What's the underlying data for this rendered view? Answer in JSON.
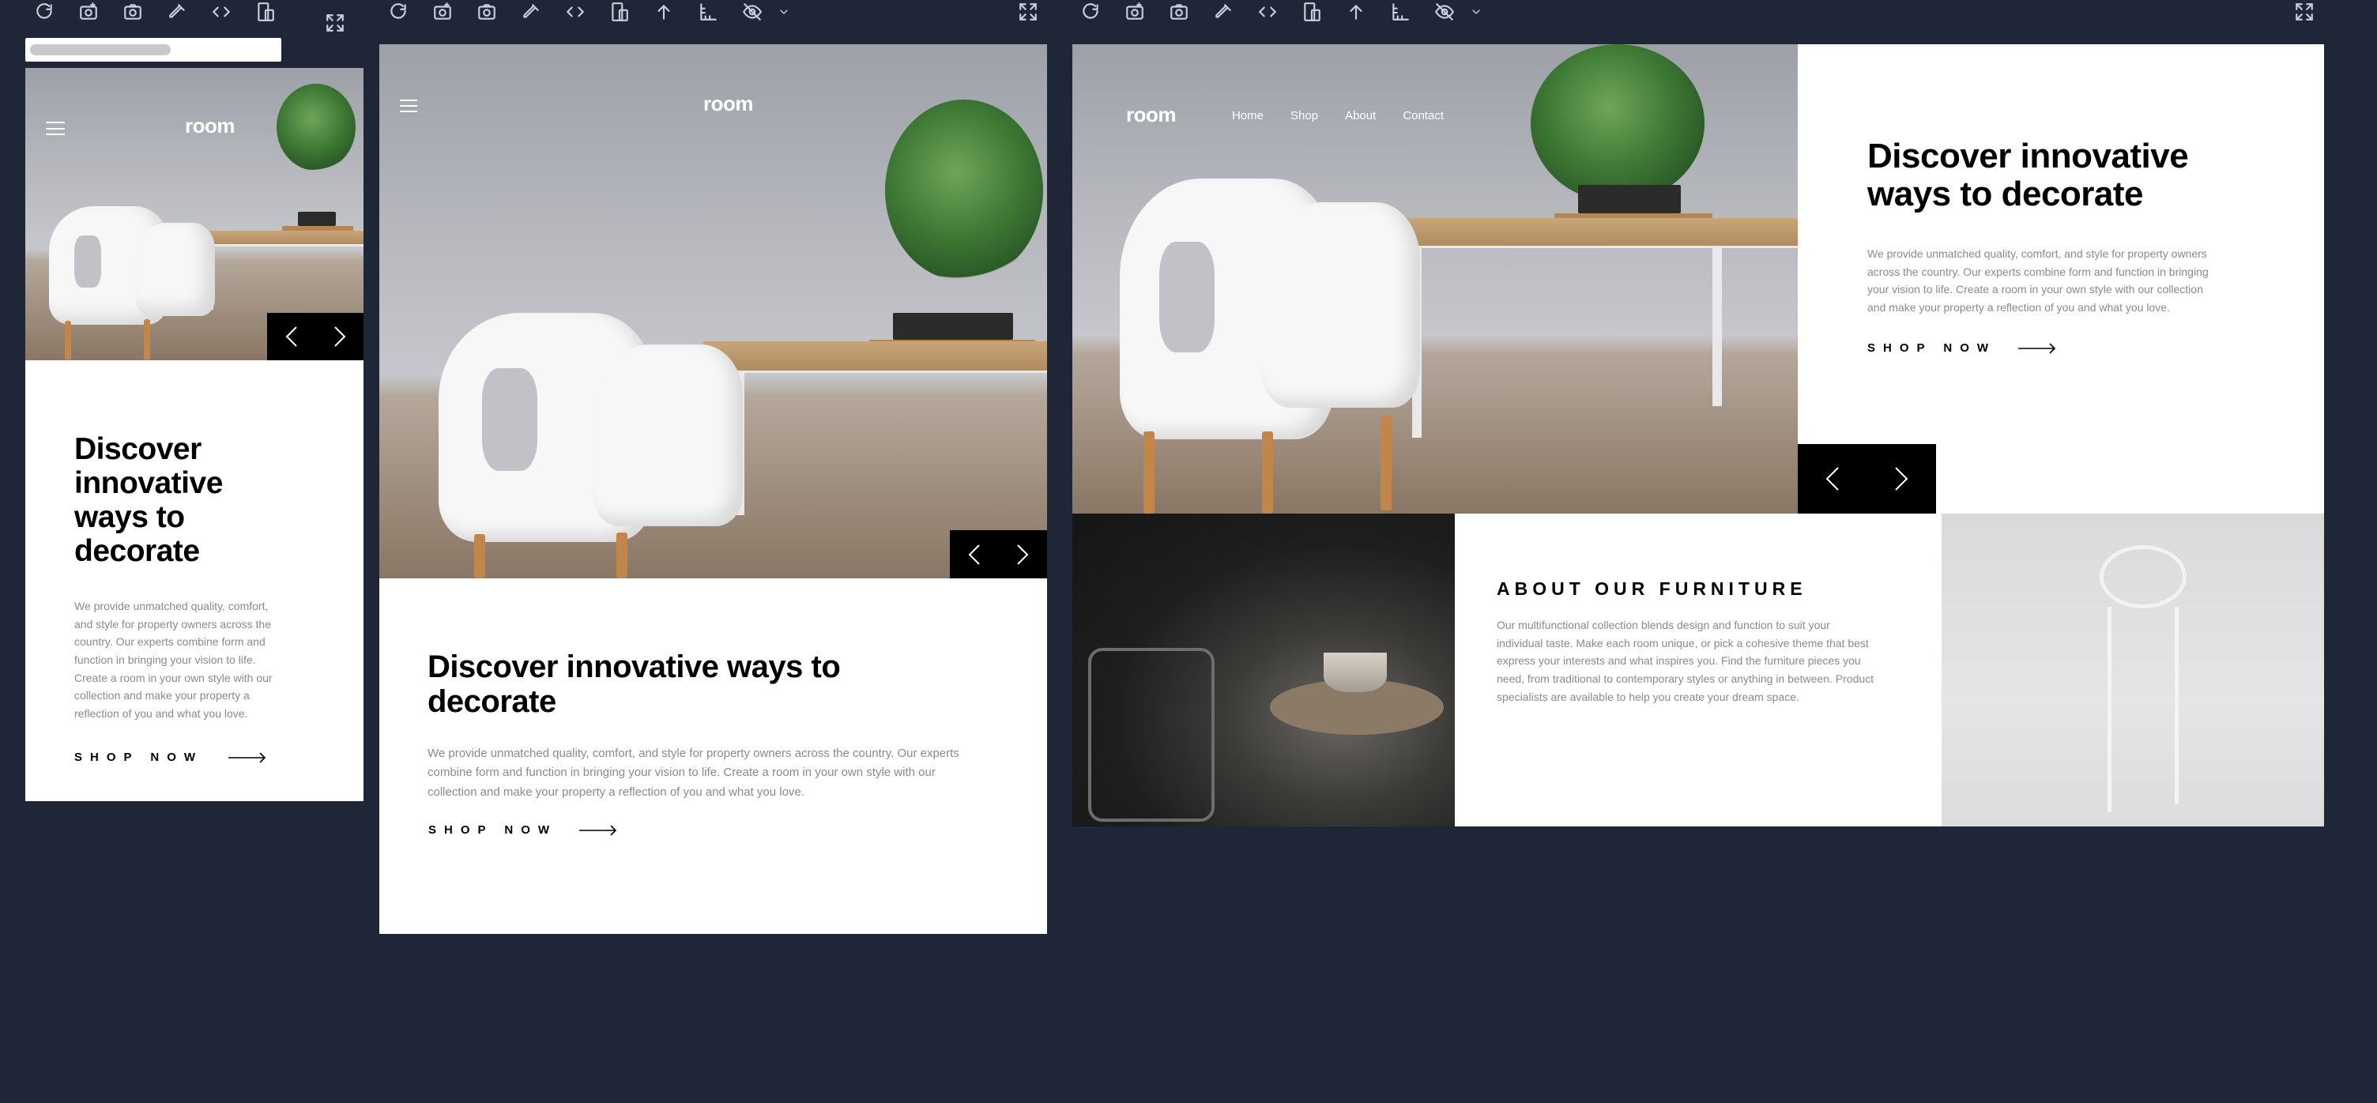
{
  "colors": {
    "background": "#1f2638",
    "accent": "#000000",
    "body_text": "#8a8a8a"
  },
  "toolbar_icons": [
    "refresh-icon",
    "camera-plus-icon",
    "camera-icon",
    "eyedropper-icon",
    "code-icon",
    "devices-icon",
    "upload-icon",
    "ruler-icon",
    "eye-off-icon",
    "chevron-down-icon",
    "expand-icon"
  ],
  "site": {
    "logo": "room",
    "nav": [
      "Home",
      "Shop",
      "About",
      "Contact"
    ],
    "hero": {
      "title": "Discover innovative ways to decorate",
      "body": "We provide unmatched quality, comfort, and style for property owners across the country. Our experts combine form and function in bringing your vision to life. Create a room in your own style with our collection and make your property a reflection of you and what you love.",
      "cta": "SHOP NOW"
    },
    "about": {
      "title": "ABOUT OUR FURNITURE",
      "body": "Our multifunctional collection blends design and function to suit your individual taste. Make each room unique, or pick a cohesive theme that best express your interests and what inspires you. Find the furniture pieces you need, from traditional to contemporary styles or anything in between. Product specialists are available to help you create your dream space."
    }
  },
  "mobile": {
    "title_lines": [
      "Discover",
      "innovative",
      "ways to",
      "decorate"
    ],
    "body_lines": [
      "We provide unmatched quality, comfort,",
      "and style for property owners across the",
      "country. Our experts combine form and",
      "function in bringing your vision to life.",
      "Create a room in your own style with our",
      "collection and make your property a",
      "reflection of you and what you love."
    ]
  },
  "tablet": {
    "title_lines": [
      "Discover innovative ways to",
      "decorate"
    ],
    "body_lines": [
      "We provide unmatched quality, comfort, and style for property owners across the country. Our experts",
      "combine form and function in bringing your vision to life. Create a room in your own style with our",
      "collection and make your property a reflection of you and what you love."
    ]
  },
  "desktop": {
    "title_lines": [
      "Discover innovative",
      "ways to decorate"
    ],
    "body_lines": [
      "We provide unmatched quality, comfort, and style for property owners",
      "across the country. Our experts combine form and function in bringing",
      "your vision to life. Create a room in your own style with our collection",
      "and make your property a reflection of you and what you love."
    ],
    "about_lines": [
      "Our multifunctional collection blends design and function to suit your",
      "individual taste. Make each room unique, or pick a cohesive theme that best",
      "express your interests and what inspires you. Find the furniture pieces you",
      "need, from traditional to contemporary styles or anything in between. Product",
      "specialists are available to help you create your dream space."
    ]
  }
}
